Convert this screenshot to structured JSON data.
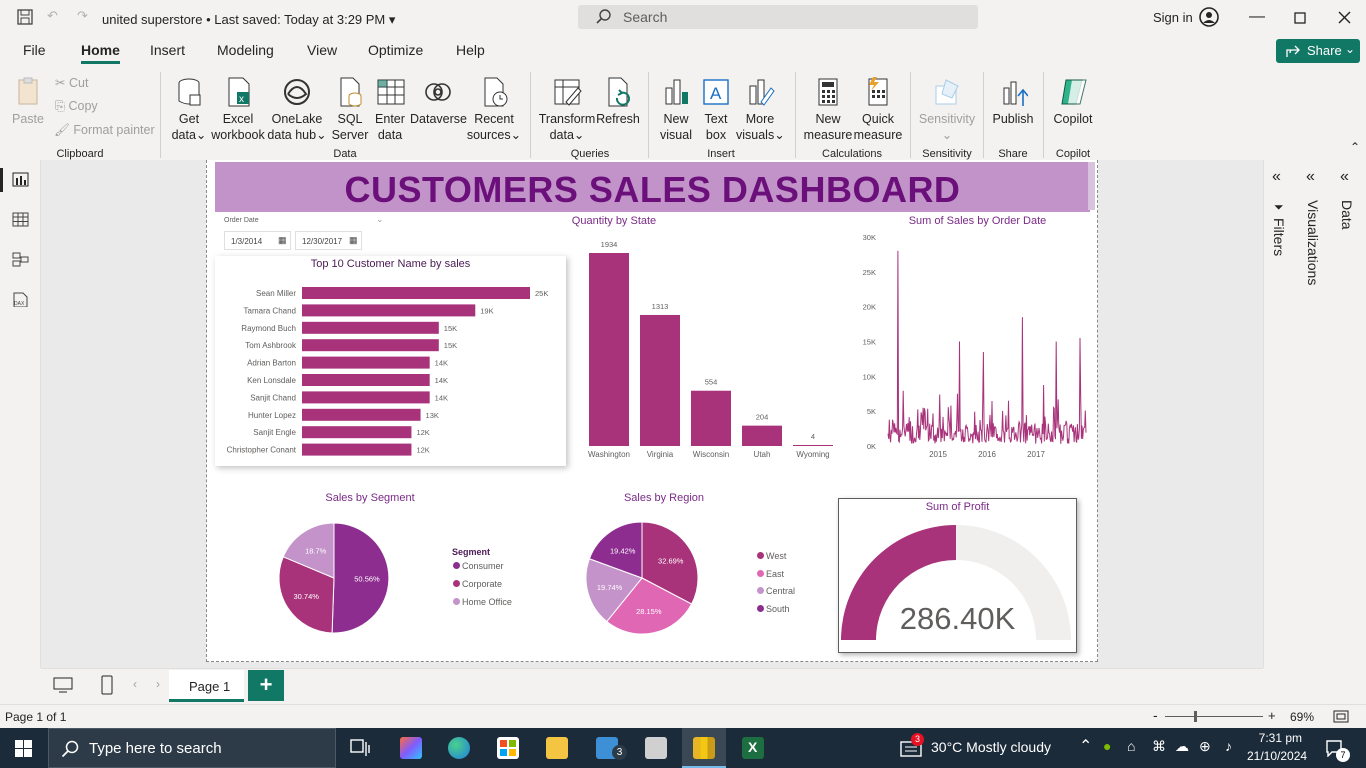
{
  "window": {
    "title": "united superstore",
    "saved": "Last saved: Today at 3:29 PM",
    "search_placeholder": "Search",
    "sign_in": "Sign in"
  },
  "menu": {
    "tabs": [
      "File",
      "Home",
      "Insert",
      "Modeling",
      "View",
      "Optimize",
      "Help"
    ],
    "active": "Home",
    "share": "Share"
  },
  "ribbon": {
    "clipboard": {
      "paste": "Paste",
      "cut": "Cut",
      "copy": "Copy",
      "format_painter": "Format painter",
      "group": "Clipboard"
    },
    "data": {
      "get_data": [
        "Get",
        "data"
      ],
      "excel": [
        "Excel",
        "workbook"
      ],
      "onelake": [
        "OneLake",
        "data hub"
      ],
      "sql": [
        "SQL",
        "Server"
      ],
      "enter": [
        "Enter",
        "data"
      ],
      "dataverse": "Dataverse",
      "recent": [
        "Recent",
        "sources"
      ],
      "group": "Data"
    },
    "queries": {
      "transform": [
        "Transform",
        "data"
      ],
      "refresh": "Refresh",
      "group": "Queries"
    },
    "insert": {
      "new_visual": [
        "New",
        "visual"
      ],
      "text_box": [
        "Text",
        "box"
      ],
      "more_visuals": [
        "More",
        "visuals"
      ],
      "group": "Insert"
    },
    "calculations": {
      "new_measure": [
        "New",
        "measure"
      ],
      "quick_measure": [
        "Quick",
        "measure"
      ],
      "group": "Calculations"
    },
    "sensitivity": {
      "label": "Sensitivity",
      "group": "Sensitivity"
    },
    "share": {
      "publish": "Publish",
      "group": "Share"
    },
    "copilot": {
      "label": "Copilot",
      "group": "Copilot"
    }
  },
  "dashboard": {
    "title": "CUSTOMERS SALES DASHBOARD",
    "slicer": {
      "label": "Order Date",
      "start": "1/3/2014",
      "end": "12/30/2017"
    },
    "profit": {
      "title": "Sum of Profit",
      "value": "286.40K"
    }
  },
  "chart_data": [
    {
      "type": "bar",
      "orientation": "horizontal",
      "title": "Top 10 Customer Name by sales",
      "categories": [
        "Sean Miller",
        "Tamara Chand",
        "Raymond Buch",
        "Tom Ashbrook",
        "Adrian Barton",
        "Ken Lonsdale",
        "Sanjit Chand",
        "Hunter Lopez",
        "Sanjit Engle",
        "Christopher Conant"
      ],
      "values": [
        25000,
        19000,
        15000,
        15000,
        14000,
        14000,
        14000,
        13000,
        12000,
        12000
      ],
      "labels": [
        "25K",
        "19K",
        "15K",
        "15K",
        "14K",
        "14K",
        "14K",
        "13K",
        "12K",
        "12K"
      ],
      "color": "#a8337a"
    },
    {
      "type": "bar",
      "title": "Quantity by State",
      "categories": [
        "Washington",
        "Virginia",
        "Wisconsin",
        "Utah",
        "Wyoming"
      ],
      "values": [
        1934,
        1313,
        554,
        204,
        4
      ],
      "color": "#a8337a"
    },
    {
      "type": "line",
      "title": "Sum of Sales by Order Date",
      "x_ticks": [
        "2015",
        "2016",
        "2017"
      ],
      "y_ticks": [
        "0K",
        "5K",
        "10K",
        "15K",
        "20K",
        "25K",
        "30K"
      ],
      "ylim": [
        0,
        30000
      ],
      "peaks": [
        {
          "pos": 0.05,
          "value": 28000
        },
        {
          "pos": 0.36,
          "value": 15000
        },
        {
          "pos": 0.48,
          "value": 13500
        },
        {
          "pos": 0.68,
          "value": 18500
        },
        {
          "pos": 0.85,
          "value": 15000
        },
        {
          "pos": 0.97,
          "value": 15500
        }
      ],
      "color": "#a8337a"
    },
    {
      "type": "pie",
      "title": "Sales by Segment",
      "legend_title": "Segment",
      "slices": [
        {
          "name": "Consumer",
          "value": 50.56,
          "label": "50.56%",
          "color": "#8c2d8f"
        },
        {
          "name": "Corporate",
          "value": 30.74,
          "label": "30.74%",
          "color": "#a8337a"
        },
        {
          "name": "Home Office",
          "value": 18.7,
          "label": "18.7%",
          "color": "#c393c9"
        }
      ]
    },
    {
      "type": "pie",
      "title": "Sales by Region",
      "slices": [
        {
          "name": "West",
          "value": 32.69,
          "label": "32.69%",
          "color": "#a8337a"
        },
        {
          "name": "East",
          "value": 28.15,
          "label": "28.15%",
          "color": "#e067b4"
        },
        {
          "name": "Central",
          "value": 19.74,
          "label": "19.74%",
          "color": "#c393c9"
        },
        {
          "name": "South",
          "value": 19.42,
          "label": "19.42%",
          "color": "#8c2d8f"
        }
      ]
    },
    {
      "type": "gauge",
      "title": "Sum of Profit",
      "value_fraction": 0.5,
      "color": "#a8337a"
    }
  ],
  "panes": {
    "filters": "Filters",
    "visualizations": "Visualizations",
    "data": "Data"
  },
  "pages": {
    "tab": "Page 1",
    "add": "+"
  },
  "status": {
    "page": "Page 1 of 1",
    "zoom": "69%"
  },
  "taskbar": {
    "search": "Type here to search",
    "weather": "30°C  Mostly cloudy",
    "time": "7:31 pm",
    "date": "21/10/2024",
    "mail_badge": "3",
    "notif_badge": "7",
    "news_badge": "3"
  }
}
